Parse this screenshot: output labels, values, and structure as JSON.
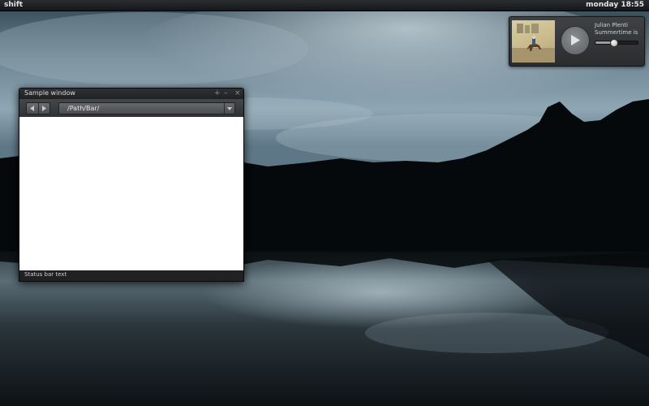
{
  "panel": {
    "app_name": "shift",
    "clock": "monday 18:55"
  },
  "music": {
    "artist": "Julian Plenti",
    "title": "Summertime is",
    "volume": 0.42,
    "play_icon": "play-icon"
  },
  "window": {
    "title": "Sample window",
    "controls": {
      "maximize": "+",
      "minimize": "–",
      "close": "×"
    },
    "path": "/Path/Bar/",
    "status": "Status bar text"
  }
}
